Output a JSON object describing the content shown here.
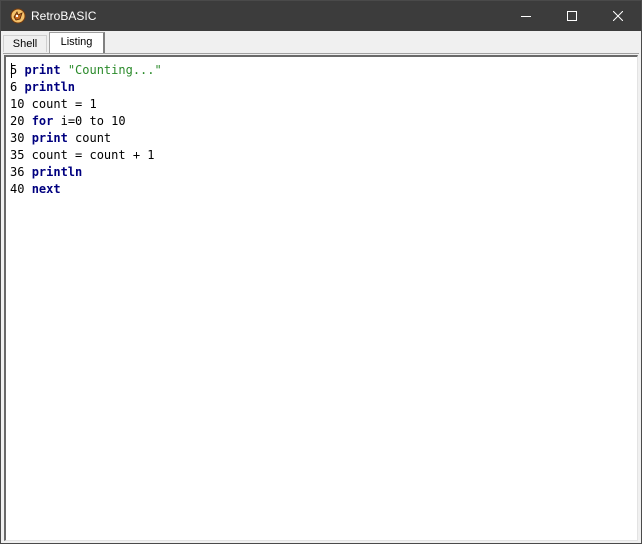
{
  "window": {
    "title": "RetroBASIC",
    "icon": "retrobasic-app-icon",
    "controls": [
      "minimize-icon",
      "maximize-icon",
      "close-icon"
    ],
    "titlebar_color": "#3c3c3c"
  },
  "tabs": [
    {
      "label": "Shell",
      "active": false
    },
    {
      "label": "Listing",
      "active": true
    }
  ],
  "editor": {
    "keyword_color": "#00007f",
    "string_color": "#2a8a2a",
    "lines": [
      [
        {
          "t": "n",
          "v": "5 "
        },
        {
          "t": "kw",
          "v": "print"
        },
        {
          "t": "n",
          "v": " "
        },
        {
          "t": "str",
          "v": "\"Counting...\""
        }
      ],
      [
        {
          "t": "n",
          "v": "6 "
        },
        {
          "t": "kw",
          "v": "println"
        }
      ],
      [
        {
          "t": "n",
          "v": "10 count = 1"
        }
      ],
      [
        {
          "t": "n",
          "v": "20 "
        },
        {
          "t": "kw",
          "v": "for"
        },
        {
          "t": "n",
          "v": " i=0 to 10"
        }
      ],
      [
        {
          "t": "n",
          "v": "30 "
        },
        {
          "t": "kw",
          "v": "print"
        },
        {
          "t": "n",
          "v": " count"
        }
      ],
      [
        {
          "t": "n",
          "v": "35 count = count + 1"
        }
      ],
      [
        {
          "t": "n",
          "v": "36 "
        },
        {
          "t": "kw",
          "v": "println"
        }
      ],
      [
        {
          "t": "n",
          "v": "40 "
        },
        {
          "t": "kw",
          "v": "next"
        }
      ]
    ]
  }
}
